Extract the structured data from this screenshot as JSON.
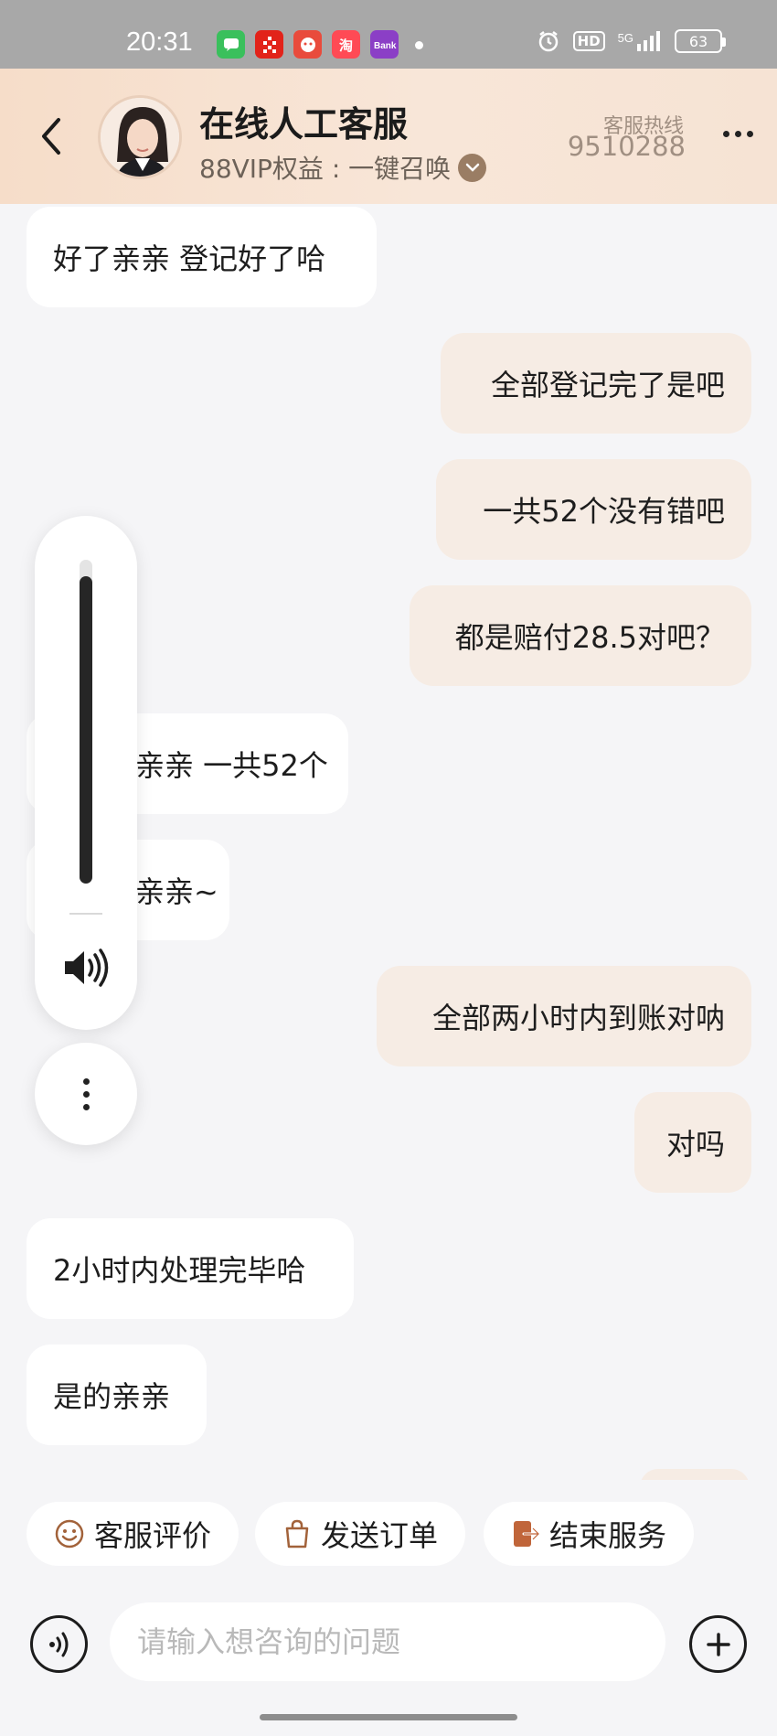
{
  "status_bar": {
    "time": "20:31",
    "app_icons": [
      "messages-app",
      "kfc-app",
      "meituan-app",
      "taobao-app",
      "bank-app"
    ],
    "network": "5G",
    "hd_label": "HD",
    "battery": "63"
  },
  "header": {
    "title": "在线人工客服",
    "vip_text": "88VIP权益 : 一键召唤",
    "hotline_label": "客服热线",
    "hotline_number": "9510288",
    "accent_color": "#f6ddc9"
  },
  "messages": [
    {
      "side": "left",
      "text": "好了亲亲 登记好了哈"
    },
    {
      "side": "right",
      "text": "全部登记完了是吧"
    },
    {
      "side": "right",
      "text": "一共52个没有错吧"
    },
    {
      "side": "right",
      "text": "都是赔付28.5对吧？"
    },
    {
      "side": "left",
      "text": "亲亲 一共52个"
    },
    {
      "side": "left",
      "text": "亲亲~"
    },
    {
      "side": "right",
      "text": "全部两小时内到账对呐"
    },
    {
      "side": "right",
      "text": "对吗"
    },
    {
      "side": "left",
      "text": "2小时内处理完毕哈"
    },
    {
      "side": "left",
      "text": "是的亲亲"
    }
  ],
  "volume_overlay": {
    "level": 0.95,
    "icon": "speaker-icon"
  },
  "quick_actions": [
    {
      "label": "客服评价",
      "icon": "smile-icon"
    },
    {
      "label": "发送订单",
      "icon": "bag-icon"
    },
    {
      "label": "结束服务",
      "icon": "exit-icon"
    }
  ],
  "input": {
    "placeholder": "请输入想咨询的问题",
    "value": ""
  }
}
